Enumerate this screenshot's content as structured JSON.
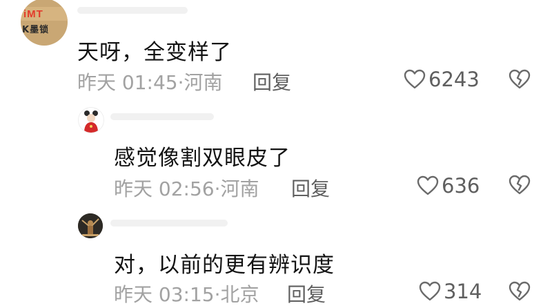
{
  "comments": [
    {
      "avatar_text": "iMT",
      "avatar_sub": "K墨锁",
      "text": "天呀，全变样了",
      "meta": "昨天 01:45·河南",
      "reply_label": "回复",
      "likes": "6243"
    },
    {
      "text": "感觉像割双眼皮了",
      "meta": "昨天 02:56·河南",
      "reply_label": "回复",
      "likes": "636"
    },
    {
      "text": "对，以前的更有辨识度",
      "meta": "昨天 03:15·北京",
      "reply_label": "回复",
      "likes": "314"
    }
  ],
  "icons": {
    "like": "heart-outline-icon",
    "dislike": "broken-heart-outline-icon"
  },
  "colors": {
    "text": "#141414",
    "meta": "#a2a2a2",
    "action": "#5f5f5f"
  }
}
